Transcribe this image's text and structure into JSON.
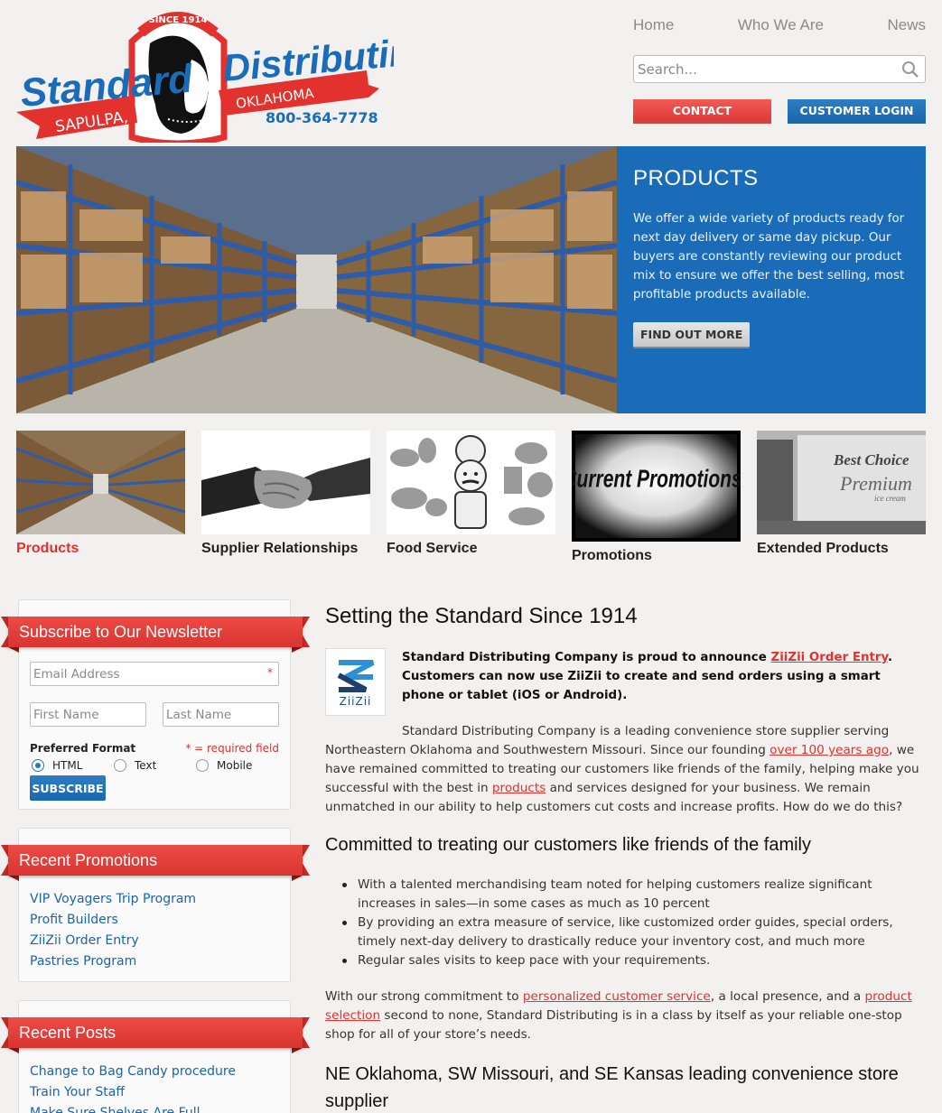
{
  "logo": {
    "text_standard": "Standard",
    "text_distributing": "Distributing",
    "text_since": "SINCE 1914",
    "text_sapulpa": "SAPULPA,",
    "text_oklahoma": "OKLAHOMA",
    "phone": "800-364-7778"
  },
  "nav": {
    "items": [
      "Home",
      "Who We Are",
      "News"
    ]
  },
  "search": {
    "placeholder": "Search..."
  },
  "header_buttons": {
    "contact": "CONTACT",
    "customer_login": "CUSTOMER LOGIN"
  },
  "hero": {
    "title": "PRODUCTS",
    "text": "We offer a wide variety of products ready for next day delivery or same day pickup. Our buyers are constantly reviewing our product mix to ensure we offer the best selling, most profitable products available.",
    "button": "FIND OUT MORE"
  },
  "tiles": [
    {
      "label": "Products"
    },
    {
      "label": "Supplier Relationships"
    },
    {
      "label": "Food Service"
    },
    {
      "label": "Promotions",
      "image_text": "Current Promotions!"
    },
    {
      "label": "Extended Products",
      "image_text_1": "Best Choice",
      "image_text_2": "Premium",
      "image_text_3": "ice cream"
    }
  ],
  "newsletter": {
    "title": "Subscribe to Our Newsletter",
    "email_placeholder": "Email Address",
    "first_placeholder": "First Name",
    "last_placeholder": "Last Name",
    "preferred_format": "Preferred Format",
    "required_note": "* = required field",
    "formats": [
      "HTML",
      "Text",
      "Mobile"
    ],
    "selected_format": "HTML",
    "button": "SUBSCRIBE"
  },
  "promotions": {
    "title": "Recent Promotions",
    "items": [
      "VIP Voyagers Trip Program",
      "Profit Builders",
      "ZiiZii Order Entry",
      "Pastries Program"
    ]
  },
  "posts": {
    "title": "Recent Posts",
    "items": [
      "Change to Bag Candy procedure",
      "Train Your Staff",
      "Make Sure Shelves Are Full"
    ]
  },
  "main": {
    "heading": "Setting the Standard Since 1914",
    "ziizi_word": "ZiiZii",
    "announce_1": "Standard Distributing Company is proud to announce ",
    "announce_link": "ZiiZii Order Entry",
    "announce_2": ".  Customers can now use ZiiZii to create and send orders using a smart phone or tablet (iOS or Android).",
    "intro_1": "Standard Distributing Company is a leading convenience store supplier serving Northeastern Oklahoma and Southwestern Missouri. Since our founding ",
    "intro_link_1": "over 100 years ago",
    "intro_2": ", we have remained committed to treating our customers like friends of the family, helping make you successful with the best in ",
    "intro_link_2": "products",
    "intro_3": " and services designed for your business. We remain unmatched in our ability to help customers cut costs and increase profits. How do we do this?",
    "heading_2": "Committed to treating our customers like friends of the family",
    "bullets": [
      "With a talented merchandising team noted for helping customers realize significant increases in sales—in some cases as much as 10 percent",
      "By providing an extra measure of service, like customized order guides, special orders, timely next-day delivery to drastically reduce your inventory cost, and much more",
      "Regular sales visits to keep pace with your requirements."
    ],
    "closing_1": "With our strong commitment to ",
    "closing_link_1": "personalized customer service",
    "closing_2": ", a local presence, and a ",
    "closing_link_2": "product selection",
    "closing_3": " second to none, Standard Distributing is in a class by itself as your reliable one-stop shop for all of your store’s needs.",
    "heading_3": "NE Oklahoma, SW Missouri, and SE Kansas leading convenience store supplier"
  },
  "colors": {
    "brand_red": "#e3312e",
    "brand_blue": "#1a6cb8",
    "link_blue": "#1a63ad"
  }
}
